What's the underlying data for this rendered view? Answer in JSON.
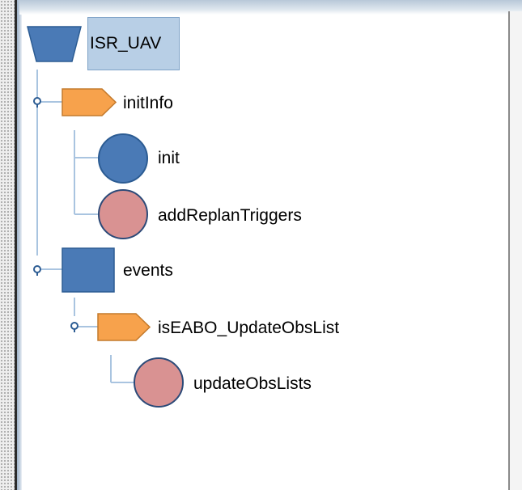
{
  "tree": {
    "root": {
      "label": "ISR_UAV",
      "icon": "trapezoid-icon",
      "color": "#4a7ab6",
      "selected": true
    },
    "nodes": [
      {
        "label": "initInfo",
        "icon": "pentagon-arrow-icon",
        "color": "#f7a24c",
        "children": [
          {
            "label": "init",
            "icon": "circle-icon",
            "color": "#4a7ab6"
          },
          {
            "label": "addReplanTriggers",
            "icon": "circle-icon",
            "color": "#d99292"
          }
        ]
      },
      {
        "label": "events",
        "icon": "square-icon",
        "color": "#4a7ab6",
        "children": [
          {
            "label": "isEABO_UpdateObsList",
            "icon": "pentagon-arrow-icon",
            "color": "#f7a24c",
            "children": [
              {
                "label": "updateObsLists",
                "icon": "circle-icon",
                "color": "#d99292"
              }
            ]
          }
        ]
      }
    ]
  }
}
